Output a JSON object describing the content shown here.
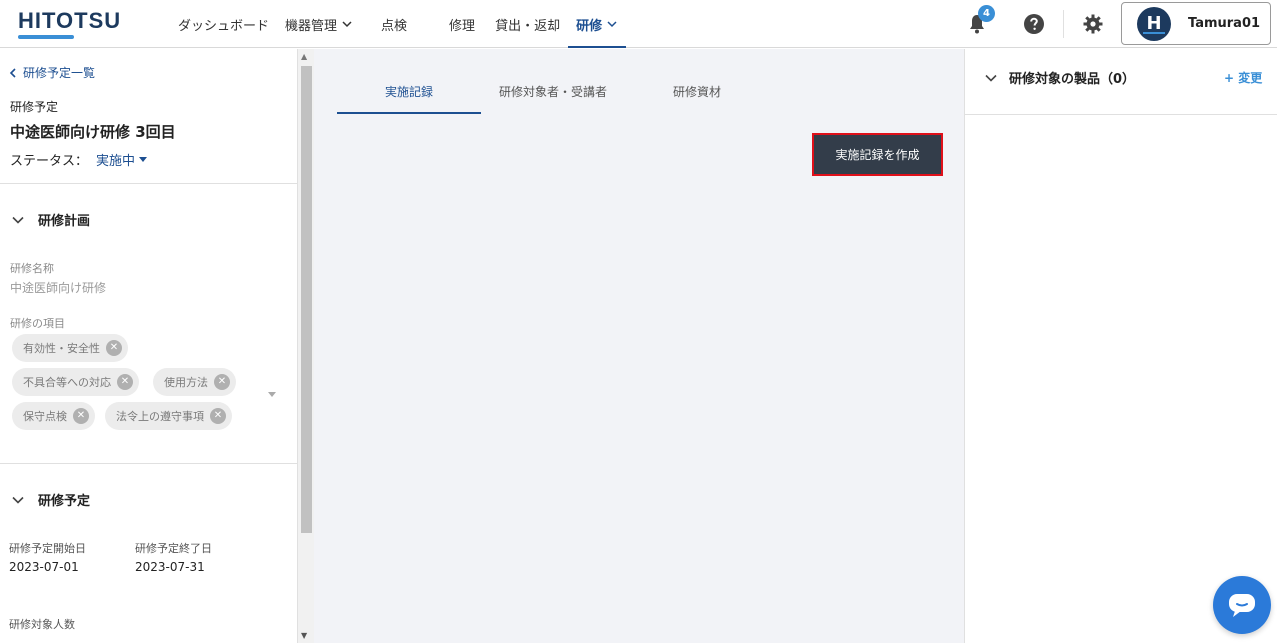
{
  "header": {
    "logo": "HITOTSU",
    "nav": [
      {
        "label": "ダッシュボード"
      },
      {
        "label": "機器管理"
      },
      {
        "label": "点検"
      },
      {
        "label": "修理"
      },
      {
        "label": "貸出・返却"
      },
      {
        "label": "研修"
      }
    ],
    "notification_count": "4",
    "user": {
      "initial": "H",
      "name": "Tamura01"
    }
  },
  "sidebar": {
    "back_label": "研修予定一覧",
    "subtitle": "研修予定",
    "title": "中途医師向け研修 3回目",
    "status_label": "ステータス：",
    "status_value": "実施中",
    "plan_section": {
      "heading": "研修計画",
      "name_label": "研修名称",
      "name_value": "中途医師向け研修",
      "items_label": "研修の項目",
      "chips": [
        "有効性・安全性",
        "不具合等への対応",
        "使用方法",
        "保守点検",
        "法令上の遵守事項"
      ]
    },
    "schedule_section": {
      "heading": "研修予定",
      "start_label": "研修予定開始日",
      "start_value": "2023-07-01",
      "end_label": "研修予定終了日",
      "end_value": "2023-07-31",
      "count_label": "研修対象人数"
    }
  },
  "main": {
    "tabs": [
      {
        "label": "実施記録"
      },
      {
        "label": "研修対象者・受講者"
      },
      {
        "label": "研修資材"
      }
    ],
    "create_button": "実施記録を作成"
  },
  "right_panel": {
    "heading": "研修対象の製品（0）",
    "change_link": "+ 変更"
  },
  "colors": {
    "accent": "#1d4f91",
    "link": "#3a8fd6",
    "button_dark": "#333d4a",
    "highlight": "#e0101a",
    "chat": "#2b7ad9"
  }
}
